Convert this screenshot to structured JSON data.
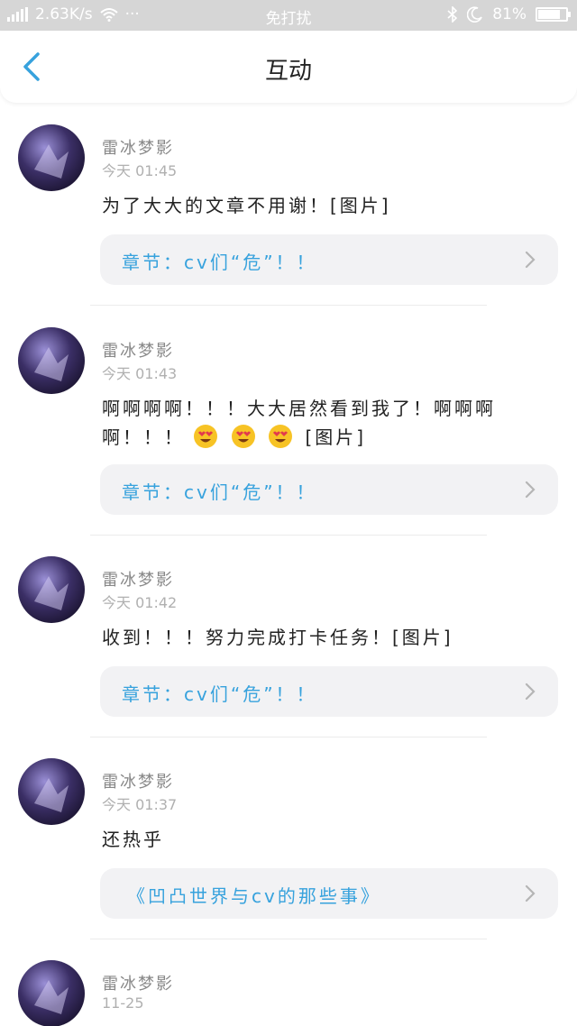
{
  "status_bar": {
    "network_speed": "2.63K/s",
    "more": "···",
    "center": "免打扰",
    "battery": "81%",
    "battery_level": 0.81,
    "color": "#d6d6d6"
  },
  "header": {
    "title": "互动",
    "back_icon": "chevron-left-icon",
    "accent": "#37a2dd"
  },
  "items": [
    {
      "name": "雷冰梦影",
      "time": "今天 01:45",
      "text": "为了大大的文章不用谢！[图片]",
      "chapter": "章节：cv们“危”！！"
    },
    {
      "name": "雷冰梦影",
      "time": "今天 01:43",
      "text": "啊啊啊啊！！！大大居然看到我了！啊啊啊啊！！！",
      "text_after": "[图片]",
      "emojis": [
        "heart-eyes-emoji",
        "heart-eyes-emoji",
        "heart-eyes-emoji"
      ],
      "chapter": "章节：cv们“危”！！"
    },
    {
      "name": "雷冰梦影",
      "time": "今天 01:42",
      "text": "收到！！！努力完成打卡任务！[图片]",
      "chapter": "章节：cv们“危”！！"
    },
    {
      "name": "雷冰梦影",
      "time": "今天 01:37",
      "text": "还热乎",
      "chapter": "《凹凸世界与cv的那些事》"
    },
    {
      "name": "雷冰梦影",
      "time": "11-25"
    }
  ]
}
